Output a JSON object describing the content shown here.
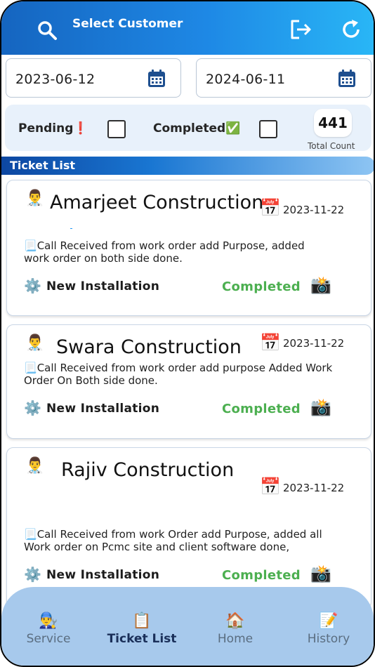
{
  "header": {
    "title": "Select Customer",
    "icons": {
      "search": "search-icon",
      "logout": "logout-icon",
      "refresh": "refresh-icon"
    }
  },
  "date_range": {
    "start": "2023-06-12",
    "end": "2024-06-11"
  },
  "filters": {
    "pending_label": "Pending",
    "pending_emoji": "❗",
    "pending_checked": false,
    "completed_label": "Completed",
    "completed_emoji": "✅",
    "completed_checked": false,
    "total_count": "441",
    "total_count_caption": "Total Count"
  },
  "list_title": "Ticket List",
  "tickets": [
    {
      "customer": "Amarjeet Construction",
      "date": "2023-11-22",
      "description": "Call Received from work order add Purpose, added work order on both side done.",
      "type": "New Installation",
      "status": "Completed"
    },
    {
      "customer": "Swara Construction",
      "date": "2023-11-22",
      "description": "Call Received from work order add purpose Added Work Order On Both side done.",
      "type": "New Installation",
      "status": "Completed"
    },
    {
      "customer": "Rajiv Construction",
      "date": "2023-11-22",
      "description": "Call Received from work Order add Purpose, added all Work order on Pcmc site and client software done,",
      "type": "New Installation",
      "status": "Completed"
    }
  ],
  "bottom_nav": [
    {
      "label": "Service",
      "icon": "👨‍🔧",
      "active": false
    },
    {
      "label": "Ticket List",
      "icon": "📋",
      "active": true
    },
    {
      "label": "Home",
      "icon": "🏠",
      "active": false
    },
    {
      "label": "History",
      "icon": "📝",
      "active": false
    }
  ],
  "colors": {
    "header_start": "#1565c0",
    "header_end": "#29b6f6",
    "status_completed": "#4caf50",
    "nav_background": "#a7c9ec",
    "filter_panel": "#e8f1fb"
  }
}
